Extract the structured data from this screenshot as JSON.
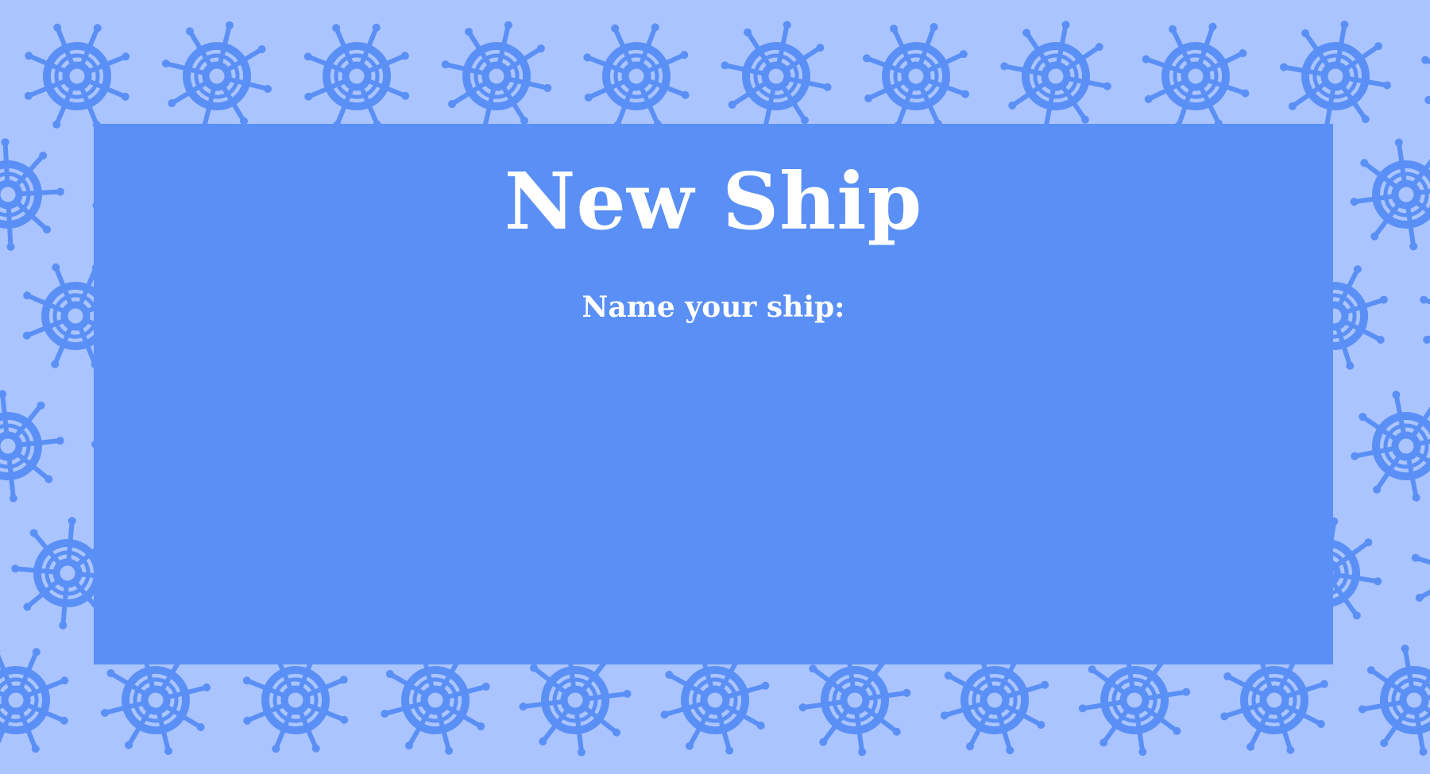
{
  "background": {
    "color": "#aac4ff",
    "pattern_icon": "ship-wheel-icon",
    "pattern_color": "#5a8ff5"
  },
  "panel": {
    "color": "#5a8ff5",
    "title": "New Ship",
    "prompt": "Name your ship:"
  }
}
